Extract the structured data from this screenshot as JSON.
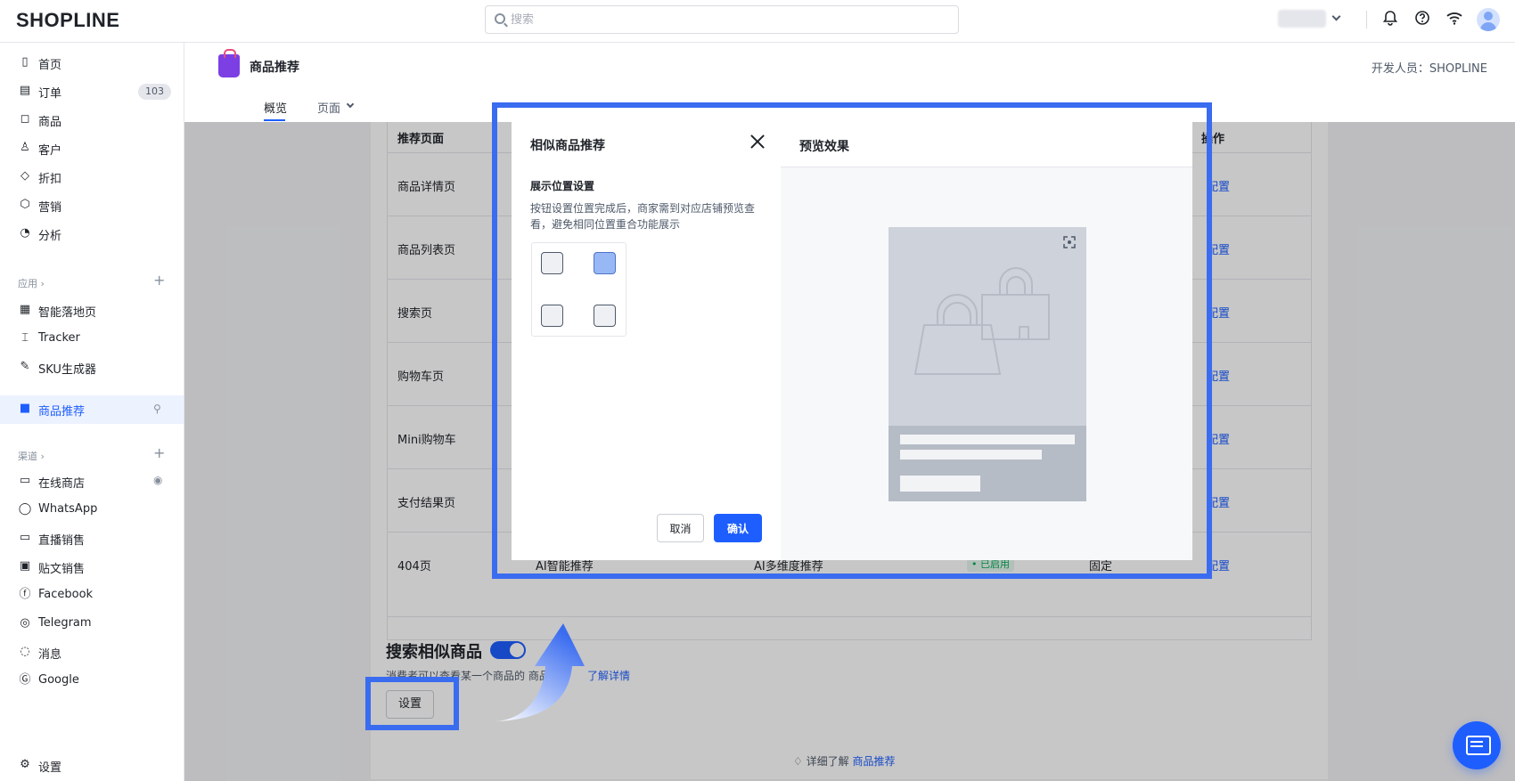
{
  "topbar": {
    "logo": "SHOPLINE",
    "search_placeholder": "搜索",
    "icons": [
      "bell-icon",
      "help-icon",
      "wifi-icon",
      "avatar"
    ]
  },
  "sidebar": {
    "main_items": [
      {
        "icon": "home-icon",
        "label": "首页"
      },
      {
        "icon": "order-icon",
        "label": "订单",
        "badge": "103"
      },
      {
        "icon": "bag-icon",
        "label": "商品"
      },
      {
        "icon": "user-icon",
        "label": "客户"
      },
      {
        "icon": "tag-icon",
        "label": "折扣"
      },
      {
        "icon": "marketing-icon",
        "label": "营销"
      },
      {
        "icon": "chart-icon",
        "label": "分析"
      }
    ],
    "apps_title": "应用 ›",
    "app_items": [
      {
        "icon": "landing-icon",
        "label": "智能落地页"
      },
      {
        "icon": "tracker-icon",
        "label": "Tracker"
      },
      {
        "icon": "sku-icon",
        "label": "SKU生成器"
      },
      {
        "icon": "recommend-icon",
        "label": "商品推荐",
        "active": true
      }
    ],
    "channels_title": "渠道 ›",
    "channel_items": [
      {
        "icon": "store-icon",
        "label": "在线商店"
      },
      {
        "icon": "whatsapp-icon",
        "label": "WhatsApp"
      },
      {
        "icon": "live-icon",
        "label": "直播销售"
      },
      {
        "icon": "post-icon",
        "label": "贴文销售"
      },
      {
        "icon": "facebook-icon",
        "label": "Facebook"
      },
      {
        "icon": "telegram-icon",
        "label": "Telegram"
      },
      {
        "icon": "message-icon",
        "label": "消息"
      },
      {
        "icon": "google-icon",
        "label": "Google"
      }
    ],
    "settings_label": "设置"
  },
  "header": {
    "title": "商品推荐",
    "developer": "开发人员：SHOPLINE",
    "tabs": [
      {
        "label": "概览",
        "active": true
      },
      {
        "label": "页面"
      }
    ]
  },
  "table": {
    "headers": [
      "推荐页面",
      "操作"
    ],
    "rows": [
      {
        "page": "商品详情页",
        "action": "配置"
      },
      {
        "page": "商品列表页",
        "action": "配置"
      },
      {
        "page": "搜索页",
        "action": "配置"
      },
      {
        "page": "购物车页",
        "action": "配置"
      },
      {
        "page": "Mini购物车",
        "action": "配置"
      },
      {
        "page": "支付结果页",
        "action": "配置"
      },
      {
        "page": "404页",
        "type": "AI智能推荐",
        "algo": "AI多维度推荐",
        "status": "• 已启用",
        "position": "固定",
        "action": "配置"
      }
    ]
  },
  "similar": {
    "title": "搜索相似商品",
    "toggle_on": true,
    "desc": "消费者可以查看某一个商品的    商品",
    "learn_more": "了解详情",
    "setting_button": "设置"
  },
  "footer": {
    "prefix": "详细了解",
    "link": "商品推荐"
  },
  "modal": {
    "title": "相似商品推荐",
    "position_title": "展示位置设置",
    "position_desc": "按钮设置位置完成后，商家需到对应店铺预览查看，避免相同位置重合功能展示",
    "positions": [
      {
        "name": "top-left",
        "selected": false
      },
      {
        "name": "top-right",
        "selected": true
      },
      {
        "name": "bottom-left",
        "selected": false
      },
      {
        "name": "bottom-right",
        "selected": false
      }
    ],
    "cancel": "取消",
    "confirm": "确认",
    "preview_title": "预览效果"
  },
  "colors": {
    "primary": "#1e5eff",
    "highlight": "#3a6cf0",
    "success": "#00a854"
  }
}
